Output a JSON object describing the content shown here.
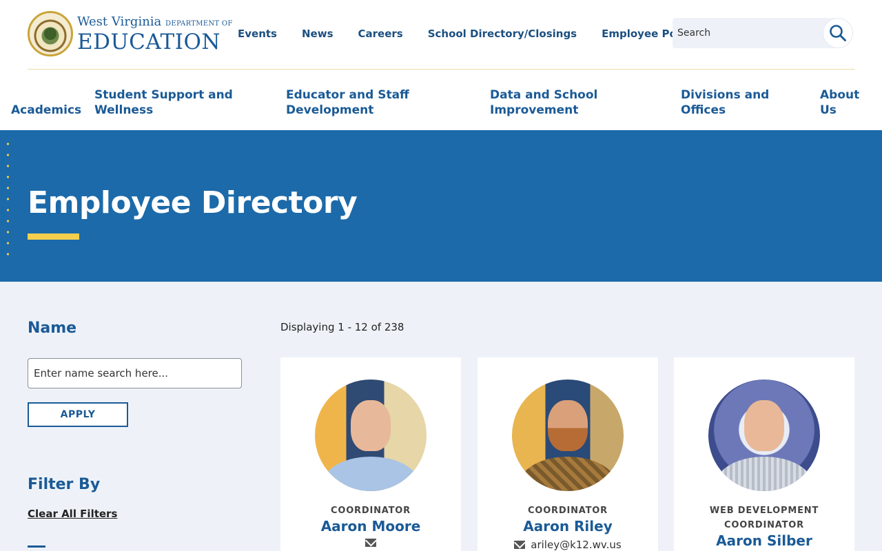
{
  "logo": {
    "line1": "West Virginia",
    "line1_small": "DEPARTMENT OF",
    "line2": "EDUCATION",
    "seal_icon": "state-seal-icon"
  },
  "topnav": [
    "Events",
    "News",
    "Careers",
    "School Directory/Closings",
    "Employee Portal"
  ],
  "search": {
    "placeholder": "Search",
    "icon": "search-icon"
  },
  "mainnav": [
    {
      "line1": "Academics",
      "line2": ""
    },
    {
      "line1": "Student Support and",
      "line2": "Wellness"
    },
    {
      "line1": "Educator and Staff",
      "line2": "Development"
    },
    {
      "line1": "Data and School",
      "line2": "Improvement"
    },
    {
      "line1": "Divisions and",
      "line2": "Offices"
    },
    {
      "line1": "About",
      "line2": "Us"
    }
  ],
  "hero": {
    "title": "Employee Directory"
  },
  "sidebar": {
    "name_title": "Name",
    "name_placeholder": "Enter name search here...",
    "apply_label": "APPLY",
    "filter_title": "Filter By",
    "clear_label": "Clear All Filters"
  },
  "results": {
    "count_text": "Displaying 1 - 12 of 238",
    "cards": [
      {
        "role": "COORDINATOR",
        "name": "Aaron Moore",
        "email": ""
      },
      {
        "role": "COORDINATOR",
        "name": "Aaron Riley",
        "email": "ariley@k12.wv.us"
      },
      {
        "role": "WEB DEVELOPMENT COORDINATOR",
        "name": "Aaron Silber",
        "email": ""
      }
    ]
  },
  "colors": {
    "brand_blue": "#1c6aa9",
    "accent_gold": "#f3cf4d",
    "link_blue": "#1a5a96"
  }
}
